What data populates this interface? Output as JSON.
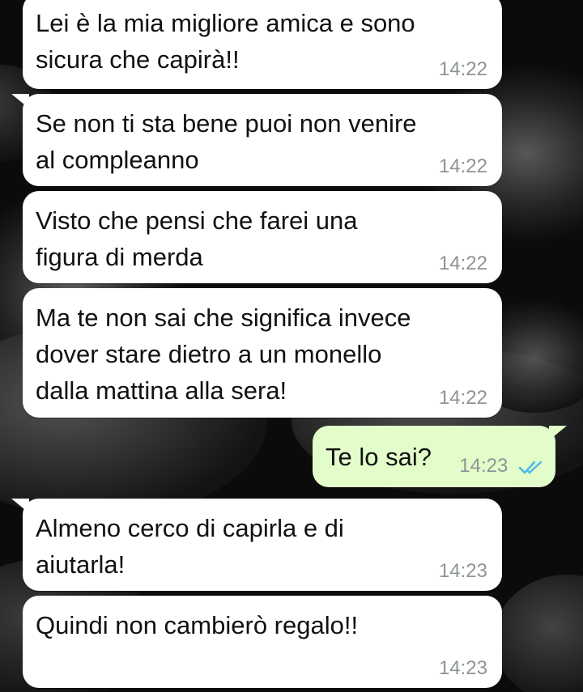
{
  "conversation": {
    "messages": [
      {
        "id": "m1",
        "direction": "incoming",
        "text": "Lei è la mia migliore amica e sono\nsicura che capirà!!",
        "time": "14:22"
      },
      {
        "id": "m2",
        "direction": "incoming",
        "text": "Se non ti sta bene puoi non venire\nal compleanno",
        "time": "14:22"
      },
      {
        "id": "m3",
        "direction": "incoming",
        "text": "Visto che pensi che farei una\nfigura di merda",
        "time": "14:22"
      },
      {
        "id": "m4",
        "direction": "incoming",
        "text": "Ma te non sai che significa invece\ndover stare dietro a un monello\ndalla mattina alla sera!",
        "time": "14:22"
      },
      {
        "id": "m5",
        "direction": "outgoing",
        "text": "Te lo sai?",
        "time": "14:23",
        "status_icon": "double-check-read-icon"
      },
      {
        "id": "m6",
        "direction": "incoming",
        "text": "Almeno cerco di capirla e di\naiutarla!",
        "time": "14:23"
      },
      {
        "id": "m7",
        "direction": "incoming",
        "text": "Quindi non cambierò regalo!!",
        "time": "14:23"
      }
    ]
  },
  "colors": {
    "incoming_bubble": "#ffffff",
    "outgoing_bubble": "#e2fdca",
    "timestamp": "#8d9498",
    "read_check": "#4fb6ec",
    "wallpaper": "#0b0b0b"
  }
}
